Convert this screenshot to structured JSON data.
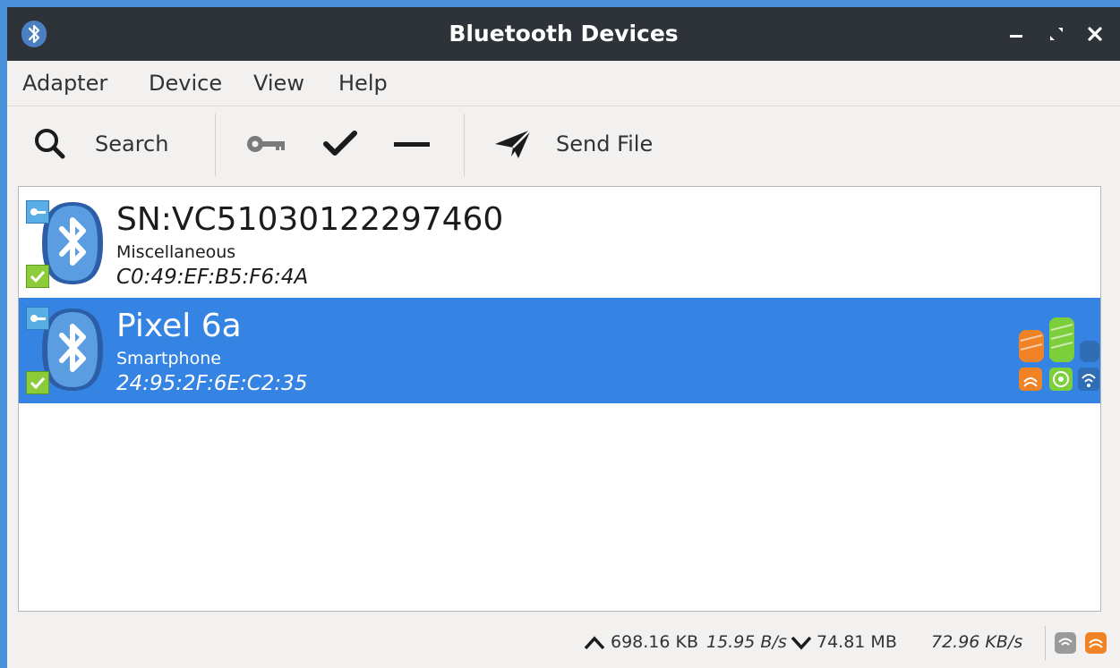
{
  "window": {
    "title": "Bluetooth Devices"
  },
  "titlebar_icons": {
    "app": "bluetooth-icon",
    "minimize": "minimize-icon",
    "maximize": "maximize-icon",
    "close": "close-icon"
  },
  "menubar": {
    "items": [
      "Adapter",
      "Device",
      "View",
      "Help"
    ]
  },
  "toolbar": {
    "search_label": "Search",
    "send_file_label": "Send File",
    "icons": [
      "search-icon",
      "key-icon",
      "check-icon",
      "remove-icon",
      "send-icon"
    ]
  },
  "devices": [
    {
      "name": "SN:VC51030122297460",
      "type": "Miscellaneous",
      "address": "C0:49:EF:B5:F6:4A",
      "selected": false,
      "paired": true,
      "trusted": true
    },
    {
      "name": "Pixel 6a",
      "type": "Smartphone",
      "address": "24:95:2F:6E:C2:35",
      "selected": true,
      "paired": true,
      "trusted": true,
      "signal_icons": [
        "signal-quality-icon",
        "signal-rssi-icon",
        "signal-tx-power-icon"
      ]
    }
  ],
  "statusbar": {
    "upload_total": "698.16 KB",
    "upload_rate": "15.95 B/s",
    "download_total": "74.81 MB",
    "download_rate": "72.96 KB/s",
    "icons": [
      "upload-arrow-icon",
      "download-arrow-icon",
      "adapter-status-icon",
      "adapter-power-icon"
    ]
  },
  "colors": {
    "selection": "#3584e4",
    "titlebar": "#2d3339",
    "accent_orange": "#f08326",
    "accent_green": "#7ccf3b"
  }
}
